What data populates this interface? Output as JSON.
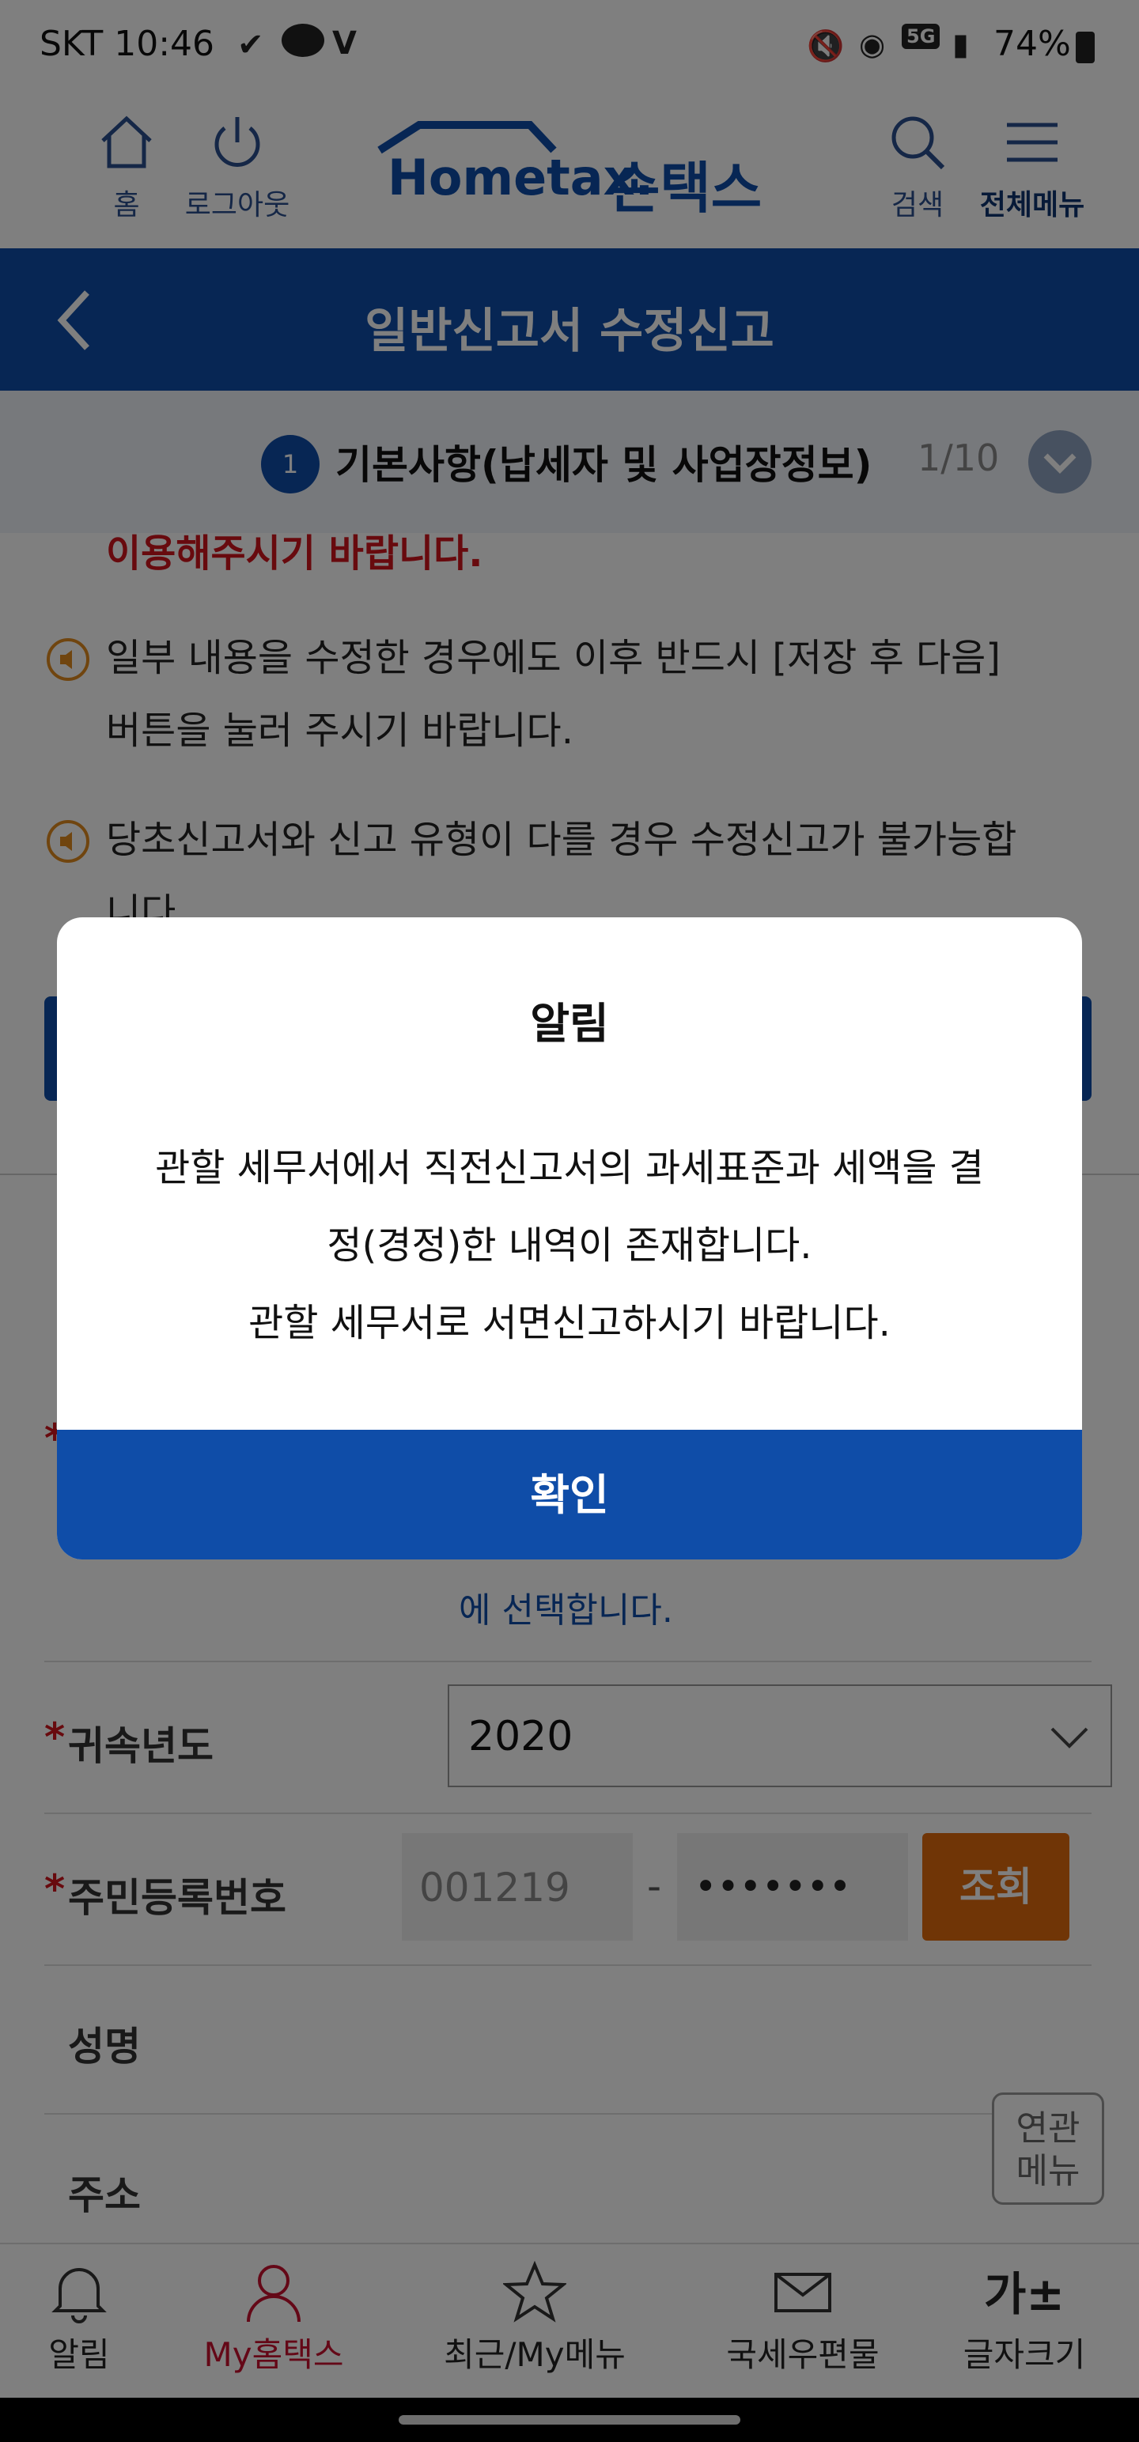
{
  "status_bar": {
    "carrier_time": "SKT 10:46",
    "network": "5G",
    "battery": "74%"
  },
  "header": {
    "home_label": "홈",
    "logout_label": "로그아웃",
    "logo_text": "Hometax.",
    "logo_sub": "손택스",
    "search_label": "검색",
    "menu_label": "전체메뉴"
  },
  "titlebar": {
    "title": "일반신고서 수정신고"
  },
  "step": {
    "number": "1",
    "title": "기본사항(납세자 및 사업장정보)",
    "count": "1/10"
  },
  "notices": {
    "red_line": "이용해주시기 바랍니다.",
    "item1_line1": "일부 내용을 수정한 경우에도 이후 반드시 [저장 후 다음]",
    "item1_line2": "버튼을 눌러 주시기 바랍니다.",
    "item2_line1": "당초신고서와 신고 유형이 다를 경우 수정신고가 불가능합",
    "item2_line2": "니다."
  },
  "form": {
    "select_hint": "에 선택합니다.",
    "year_label": "귀속년도",
    "year_value": "2020",
    "rrn_label": "주민등록번호",
    "rrn_front": "001219",
    "rrn_dash": "-",
    "rrn_back": "•••••••",
    "lookup_label": "조회",
    "name_label": "성명",
    "address_label": "주소"
  },
  "related_menu": {
    "line1": "연관",
    "line2": "메뉴"
  },
  "bottom_nav": {
    "items": [
      {
        "label": "알림"
      },
      {
        "label": "My홈택스"
      },
      {
        "label": "최근/My메뉴"
      },
      {
        "label": "국세우편물"
      },
      {
        "label": "글자크기"
      }
    ],
    "font_size_glyph": "가±"
  },
  "modal": {
    "title": "알림",
    "message_line1": "관할 세무서에서 직전신고서의 과세표준과 세액을 결",
    "message_line2": "정(경정)한 내역이 존재합니다.",
    "message_line3": "관할 세무서로 서면신고하시기 바랍니다.",
    "confirm_label": "확인"
  },
  "colors": {
    "primary": "#0f4da8",
    "accent_red": "#d0141c",
    "lookup_orange": "#e06a0c",
    "active_nav": "#c8102e"
  }
}
